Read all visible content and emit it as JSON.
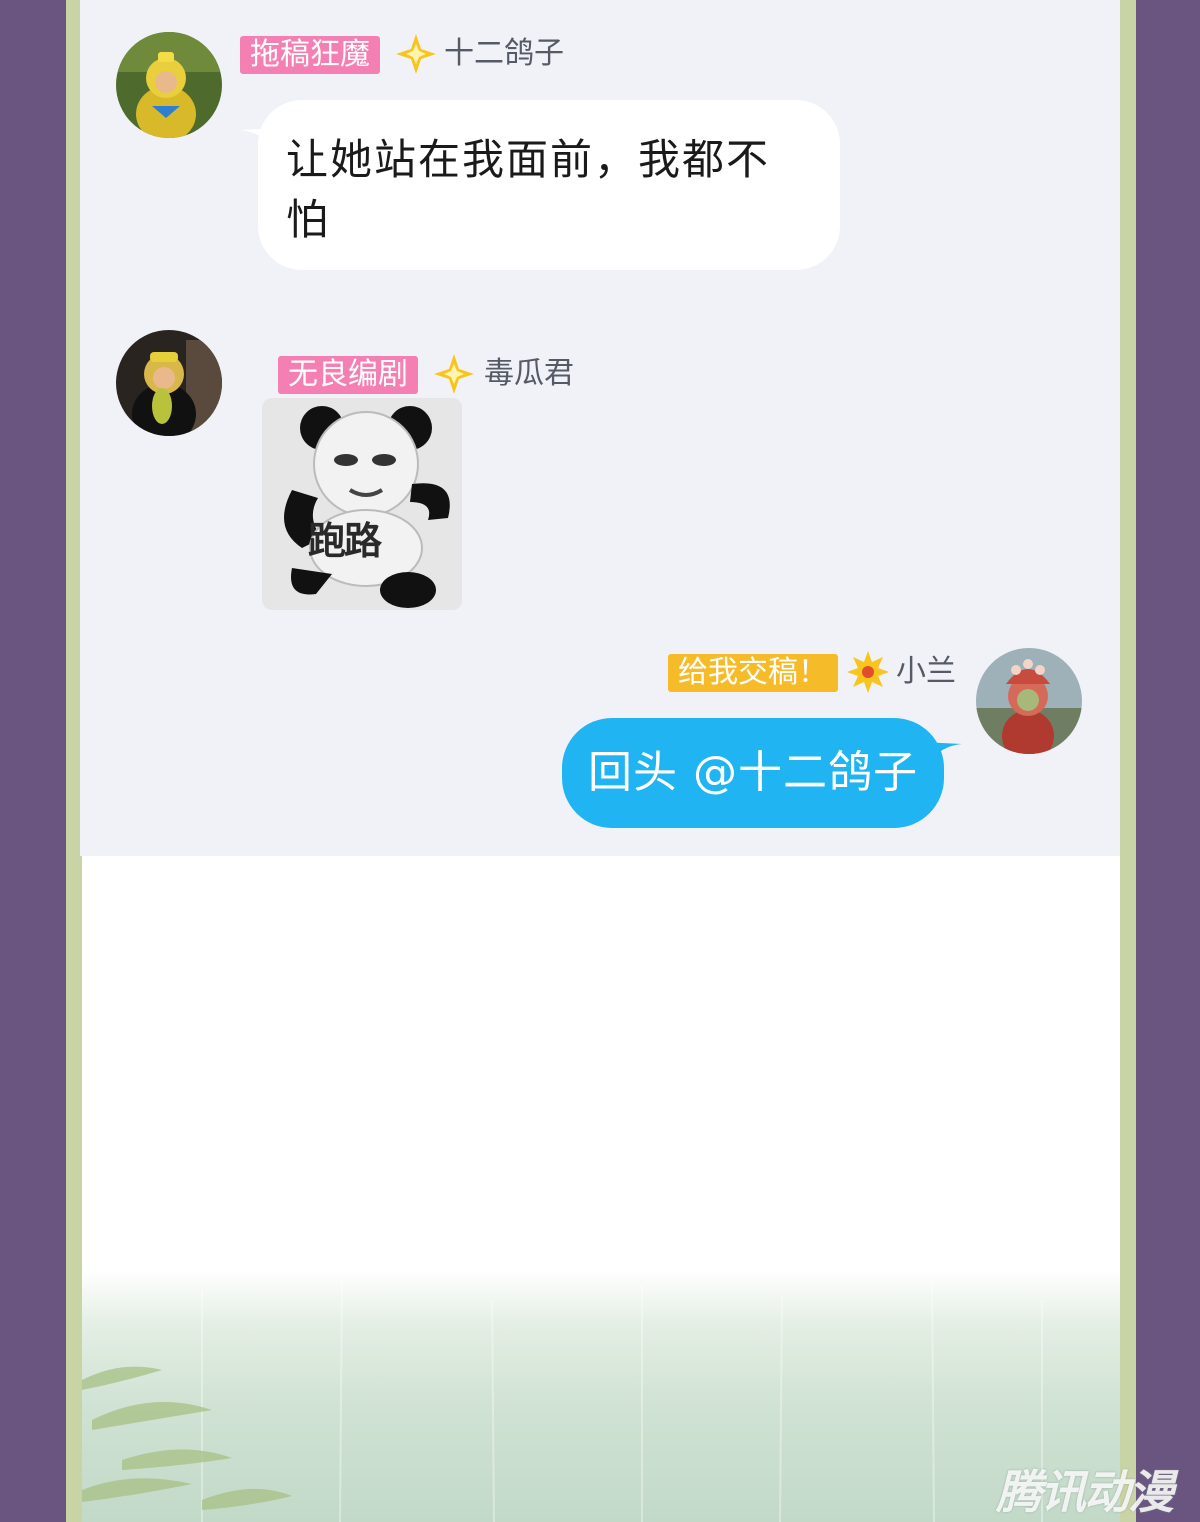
{
  "messages": [
    {
      "badge": "拖稿狂魔",
      "name": "十二鸽子",
      "text_line1": "让她站在我面前，我都不",
      "text_line2": "怕"
    },
    {
      "badge": "无良编剧",
      "name": "毒瓜君",
      "sticker_text": "跑路"
    },
    {
      "badge": "给我交稿！",
      "name": "小兰",
      "text": "回头 @十二鸽子"
    }
  ],
  "watermark": "腾讯动漫",
  "colors": {
    "badge_pink": "#f47fb3",
    "badge_yellow": "#f5bb28",
    "bubble_blue": "#21b4f3",
    "chat_bg": "#f1f2f7",
    "side_purple": "#6a5580"
  }
}
